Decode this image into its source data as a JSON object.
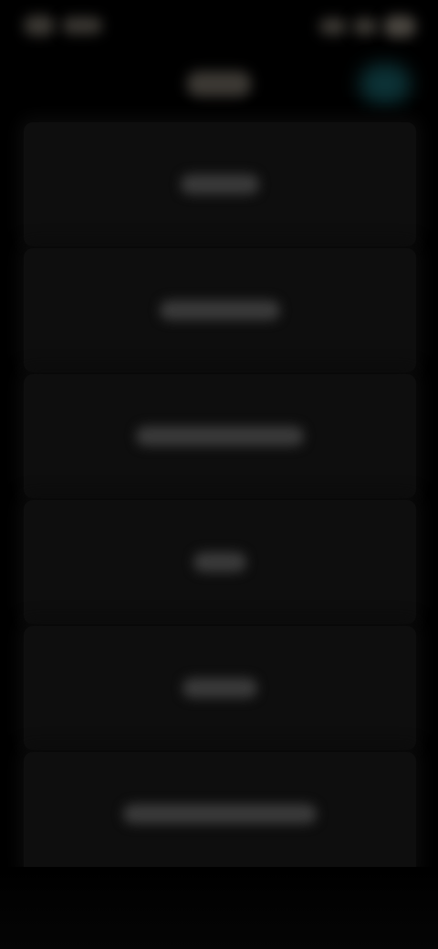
{
  "status_bar": {
    "left_icons": [
      "status-icon",
      "status-icon"
    ],
    "right_icons": [
      "signal-icon",
      "wifi-icon",
      "battery-icon"
    ]
  },
  "header": {
    "title": "",
    "action_label": ""
  },
  "menu": {
    "items": [
      {
        "label": ""
      },
      {
        "label": ""
      },
      {
        "label": ""
      },
      {
        "label": ""
      },
      {
        "label": ""
      },
      {
        "label": ""
      }
    ]
  },
  "colors": {
    "background": "#000000",
    "card": "#0e0e0e",
    "accent": "#0c3236",
    "text_blur": "#3a3a3a"
  }
}
